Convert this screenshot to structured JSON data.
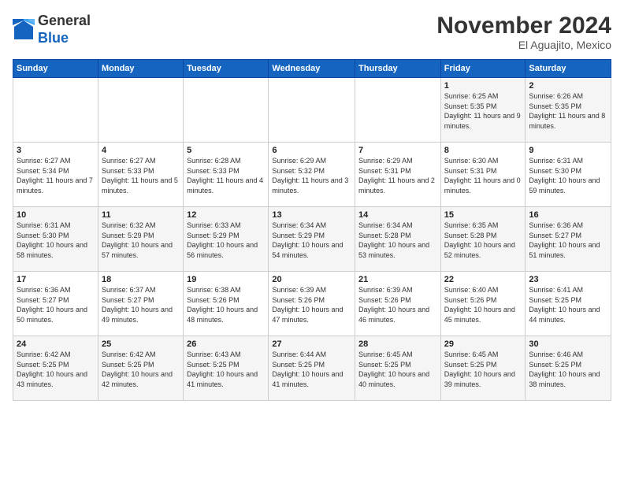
{
  "header": {
    "logo_line1": "General",
    "logo_line2": "Blue",
    "month_title": "November 2024",
    "location": "El Aguajito, Mexico"
  },
  "days_of_week": [
    "Sunday",
    "Monday",
    "Tuesday",
    "Wednesday",
    "Thursday",
    "Friday",
    "Saturday"
  ],
  "weeks": [
    [
      {
        "day": "",
        "info": ""
      },
      {
        "day": "",
        "info": ""
      },
      {
        "day": "",
        "info": ""
      },
      {
        "day": "",
        "info": ""
      },
      {
        "day": "",
        "info": ""
      },
      {
        "day": "1",
        "info": "Sunrise: 6:25 AM\nSunset: 5:35 PM\nDaylight: 11 hours and 9 minutes."
      },
      {
        "day": "2",
        "info": "Sunrise: 6:26 AM\nSunset: 5:35 PM\nDaylight: 11 hours and 8 minutes."
      }
    ],
    [
      {
        "day": "3",
        "info": "Sunrise: 6:27 AM\nSunset: 5:34 PM\nDaylight: 11 hours and 7 minutes."
      },
      {
        "day": "4",
        "info": "Sunrise: 6:27 AM\nSunset: 5:33 PM\nDaylight: 11 hours and 5 minutes."
      },
      {
        "day": "5",
        "info": "Sunrise: 6:28 AM\nSunset: 5:33 PM\nDaylight: 11 hours and 4 minutes."
      },
      {
        "day": "6",
        "info": "Sunrise: 6:29 AM\nSunset: 5:32 PM\nDaylight: 11 hours and 3 minutes."
      },
      {
        "day": "7",
        "info": "Sunrise: 6:29 AM\nSunset: 5:31 PM\nDaylight: 11 hours and 2 minutes."
      },
      {
        "day": "8",
        "info": "Sunrise: 6:30 AM\nSunset: 5:31 PM\nDaylight: 11 hours and 0 minutes."
      },
      {
        "day": "9",
        "info": "Sunrise: 6:31 AM\nSunset: 5:30 PM\nDaylight: 10 hours and 59 minutes."
      }
    ],
    [
      {
        "day": "10",
        "info": "Sunrise: 6:31 AM\nSunset: 5:30 PM\nDaylight: 10 hours and 58 minutes."
      },
      {
        "day": "11",
        "info": "Sunrise: 6:32 AM\nSunset: 5:29 PM\nDaylight: 10 hours and 57 minutes."
      },
      {
        "day": "12",
        "info": "Sunrise: 6:33 AM\nSunset: 5:29 PM\nDaylight: 10 hours and 56 minutes."
      },
      {
        "day": "13",
        "info": "Sunrise: 6:34 AM\nSunset: 5:29 PM\nDaylight: 10 hours and 54 minutes."
      },
      {
        "day": "14",
        "info": "Sunrise: 6:34 AM\nSunset: 5:28 PM\nDaylight: 10 hours and 53 minutes."
      },
      {
        "day": "15",
        "info": "Sunrise: 6:35 AM\nSunset: 5:28 PM\nDaylight: 10 hours and 52 minutes."
      },
      {
        "day": "16",
        "info": "Sunrise: 6:36 AM\nSunset: 5:27 PM\nDaylight: 10 hours and 51 minutes."
      }
    ],
    [
      {
        "day": "17",
        "info": "Sunrise: 6:36 AM\nSunset: 5:27 PM\nDaylight: 10 hours and 50 minutes."
      },
      {
        "day": "18",
        "info": "Sunrise: 6:37 AM\nSunset: 5:27 PM\nDaylight: 10 hours and 49 minutes."
      },
      {
        "day": "19",
        "info": "Sunrise: 6:38 AM\nSunset: 5:26 PM\nDaylight: 10 hours and 48 minutes."
      },
      {
        "day": "20",
        "info": "Sunrise: 6:39 AM\nSunset: 5:26 PM\nDaylight: 10 hours and 47 minutes."
      },
      {
        "day": "21",
        "info": "Sunrise: 6:39 AM\nSunset: 5:26 PM\nDaylight: 10 hours and 46 minutes."
      },
      {
        "day": "22",
        "info": "Sunrise: 6:40 AM\nSunset: 5:26 PM\nDaylight: 10 hours and 45 minutes."
      },
      {
        "day": "23",
        "info": "Sunrise: 6:41 AM\nSunset: 5:25 PM\nDaylight: 10 hours and 44 minutes."
      }
    ],
    [
      {
        "day": "24",
        "info": "Sunrise: 6:42 AM\nSunset: 5:25 PM\nDaylight: 10 hours and 43 minutes."
      },
      {
        "day": "25",
        "info": "Sunrise: 6:42 AM\nSunset: 5:25 PM\nDaylight: 10 hours and 42 minutes."
      },
      {
        "day": "26",
        "info": "Sunrise: 6:43 AM\nSunset: 5:25 PM\nDaylight: 10 hours and 41 minutes."
      },
      {
        "day": "27",
        "info": "Sunrise: 6:44 AM\nSunset: 5:25 PM\nDaylight: 10 hours and 41 minutes."
      },
      {
        "day": "28",
        "info": "Sunrise: 6:45 AM\nSunset: 5:25 PM\nDaylight: 10 hours and 40 minutes."
      },
      {
        "day": "29",
        "info": "Sunrise: 6:45 AM\nSunset: 5:25 PM\nDaylight: 10 hours and 39 minutes."
      },
      {
        "day": "30",
        "info": "Sunrise: 6:46 AM\nSunset: 5:25 PM\nDaylight: 10 hours and 38 minutes."
      }
    ]
  ]
}
